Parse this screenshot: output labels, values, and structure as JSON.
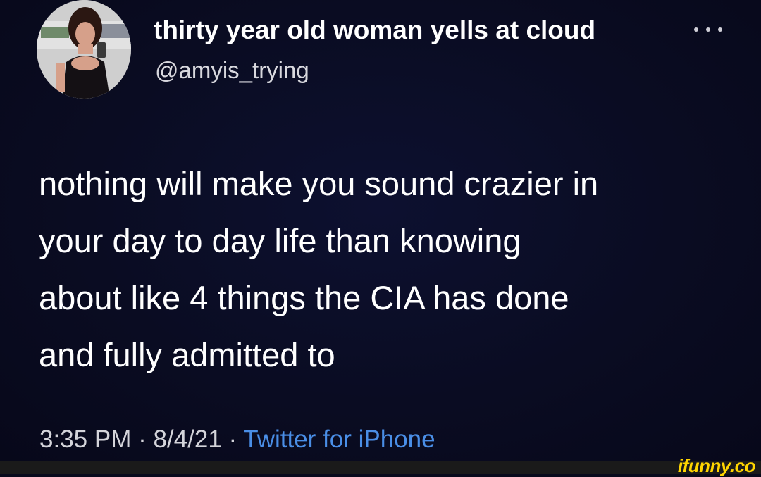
{
  "tweet": {
    "display_name": "thirty year old woman yells at cloud",
    "handle": "@amyis_trying",
    "text_lines": [
      "nothing will make you sound crazier in",
      "your day to day life than knowing",
      "about like 4 things the CIA has done",
      "and fully admitted to"
    ],
    "time": "3:35 PM",
    "date": "8/4/21",
    "separator": " · ",
    "source": "Twitter for iPhone"
  },
  "watermark": {
    "text": "ifunny.co"
  },
  "colors": {
    "background": "#080a1c",
    "text": "#ffffff",
    "source_link": "#4a8ee6",
    "watermark": "#ffd500"
  },
  "icons": {
    "more": "more-options-icon"
  }
}
